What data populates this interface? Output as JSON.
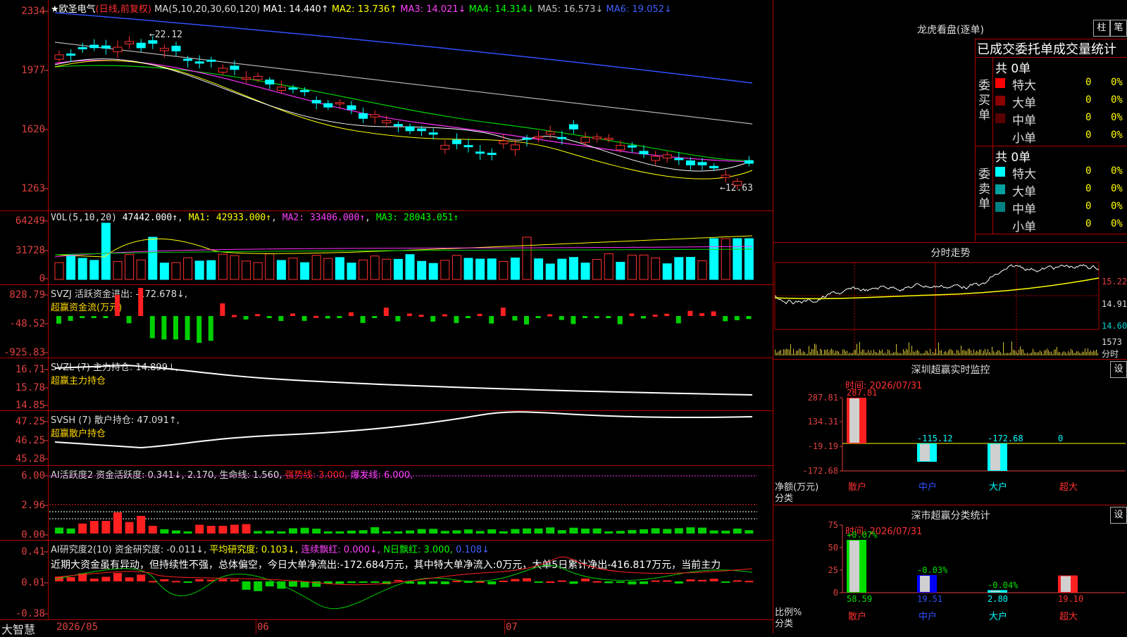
{
  "stock": {
    "name": "★欧圣电气",
    "mode": "(日线,前复权)",
    "ma_label": "MA(5,10,20,30,60,120)",
    "ma1": "MA1: 14.440↑",
    "ma2": "MA2: 13.736↑",
    "ma3": "MA3: 14.021↓",
    "ma4": "MA4: 14.314↓",
    "ma5": "MA5: 16.573↓",
    "ma6": "MA6: 19.052↓",
    "high_label": "←22.12",
    "low_label": "←12.63",
    "price_ticks": [
      "2334",
      "1977",
      "1620",
      "1263"
    ]
  },
  "vol": {
    "label": "VOL(5,10,20)",
    "value": "47442.000↑",
    "ma1": "MA1: 42933.000↑",
    "ma2": "MA2: 33406.000↑",
    "ma3": "MA3: 28043.051↑",
    "ticks": [
      "64249",
      "31728",
      "0"
    ]
  },
  "svzj": {
    "label": "SVZJ  活跃资金进出: -172.678↓,",
    "sub": "超赢资金流(万元)",
    "ticks": [
      "828.79",
      "-48.52",
      "-925.83"
    ]
  },
  "svzl": {
    "label": "SVZL (7) 主力持仓: 14.899↓,",
    "sub": "超赢主力持仓",
    "ticks": [
      "16.71",
      "15.78",
      "14.85"
    ]
  },
  "svsh": {
    "label": "SVSH (7) 散户持仓: 47.091↑,",
    "sub": "超赢散户持仓",
    "ticks": [
      "47.25",
      "46.25",
      "45.28"
    ]
  },
  "ai1": {
    "label": "AI活跃度2 资金活跃度: 0.341↓, 2.170, 生命线: 1.560,",
    "strong": "强势线: 3.000,",
    "burst": "爆发线: 6.000,",
    "ticks": [
      "6.00",
      "2.96",
      "0.00"
    ]
  },
  "ai2": {
    "label": "AI研究度2(10) 资金研究度: -0.011↓,",
    "avg": "平均研究度: 0.103↓,",
    "red": "连续飘红: 0.000↓,",
    "nred": "N日飘红: 3.000,",
    "val": "0.108↓",
    "text": "近期大资金虽有异动，但持续性不强，总体偏空，今日大单净流出:-172.684万元，其中特大单净流入:0万元，大单5日累计净出-416.817万元，当前主力",
    "ticks": [
      "0.41",
      "0.01",
      "-0.38"
    ]
  },
  "dates": [
    "2026/05",
    "06",
    "07"
  ],
  "brand": "大智慧",
  "lhb": {
    "title": "龙虎看盘(逐单)",
    "btn1": "柱",
    "btn2": "笔",
    "subtitle": "已成交委托单成交量统计",
    "buy_label": "委买单",
    "sell_label": "委卖单",
    "buy_total": "共 0单",
    "sell_total": "共 0单",
    "buy_rows": [
      {
        "name": "特大",
        "count": "0",
        "pct": "0%",
        "color": "#ff0000"
      },
      {
        "name": "大单",
        "count": "0",
        "pct": "0%",
        "color": "#8b0000"
      },
      {
        "name": "中单",
        "count": "0",
        "pct": "0%",
        "color": "#5a0000"
      },
      {
        "name": "小单",
        "count": "0",
        "pct": "0%",
        "color": "#000000"
      }
    ],
    "sell_rows": [
      {
        "name": "特大",
        "count": "0",
        "pct": "0%",
        "color": "#00ffff"
      },
      {
        "name": "大单",
        "count": "0",
        "pct": "0%",
        "color": "#00a0a0"
      },
      {
        "name": "中单",
        "count": "0",
        "pct": "0%",
        "color": "#008080"
      },
      {
        "name": "小单",
        "count": "0",
        "pct": "0%",
        "color": "#000000"
      }
    ]
  },
  "intraday": {
    "title": "分时走势",
    "ticks": [
      "15.22",
      "14.91",
      "14.60"
    ],
    "vol_tick": "1573",
    "vol_unit": "分时"
  },
  "monitor": {
    "title": "深圳超赢实时监控",
    "btn": "设",
    "time": "时间: 2026/07/31",
    "ticks": [
      "287.81",
      "134.31",
      "-19.19",
      "-172.68"
    ],
    "ylabel1": "净额(万元)",
    "ylabel2": "分类",
    "bars": [
      {
        "cat": "散户",
        "value": 287.81,
        "label": "287.81"
      },
      {
        "cat": "中户",
        "value": -115.12,
        "label": "-115.12"
      },
      {
        "cat": "大户",
        "value": -172.68,
        "label": "-172.68"
      },
      {
        "cat": "超大",
        "value": 0,
        "label": "0"
      }
    ]
  },
  "classify": {
    "title": "深市超赢分类统计",
    "btn": "设",
    "time": "时间: 2026/07/31",
    "ticks": [
      "75",
      "50",
      "25",
      "0"
    ],
    "ylabel1": "比例%",
    "ylabel2": "分类",
    "bars": [
      {
        "cat": "散户",
        "value": 58.59,
        "label": "58.59",
        "change": "+0.07%"
      },
      {
        "cat": "中户",
        "value": 19.51,
        "label": "19.51",
        "change": "-0.03%"
      },
      {
        "cat": "大户",
        "value": 2.8,
        "label": "2.80",
        "change": "-0.04%"
      },
      {
        "cat": "超大",
        "value": 19.1,
        "label": "19.10",
        "change": ""
      }
    ]
  }
}
